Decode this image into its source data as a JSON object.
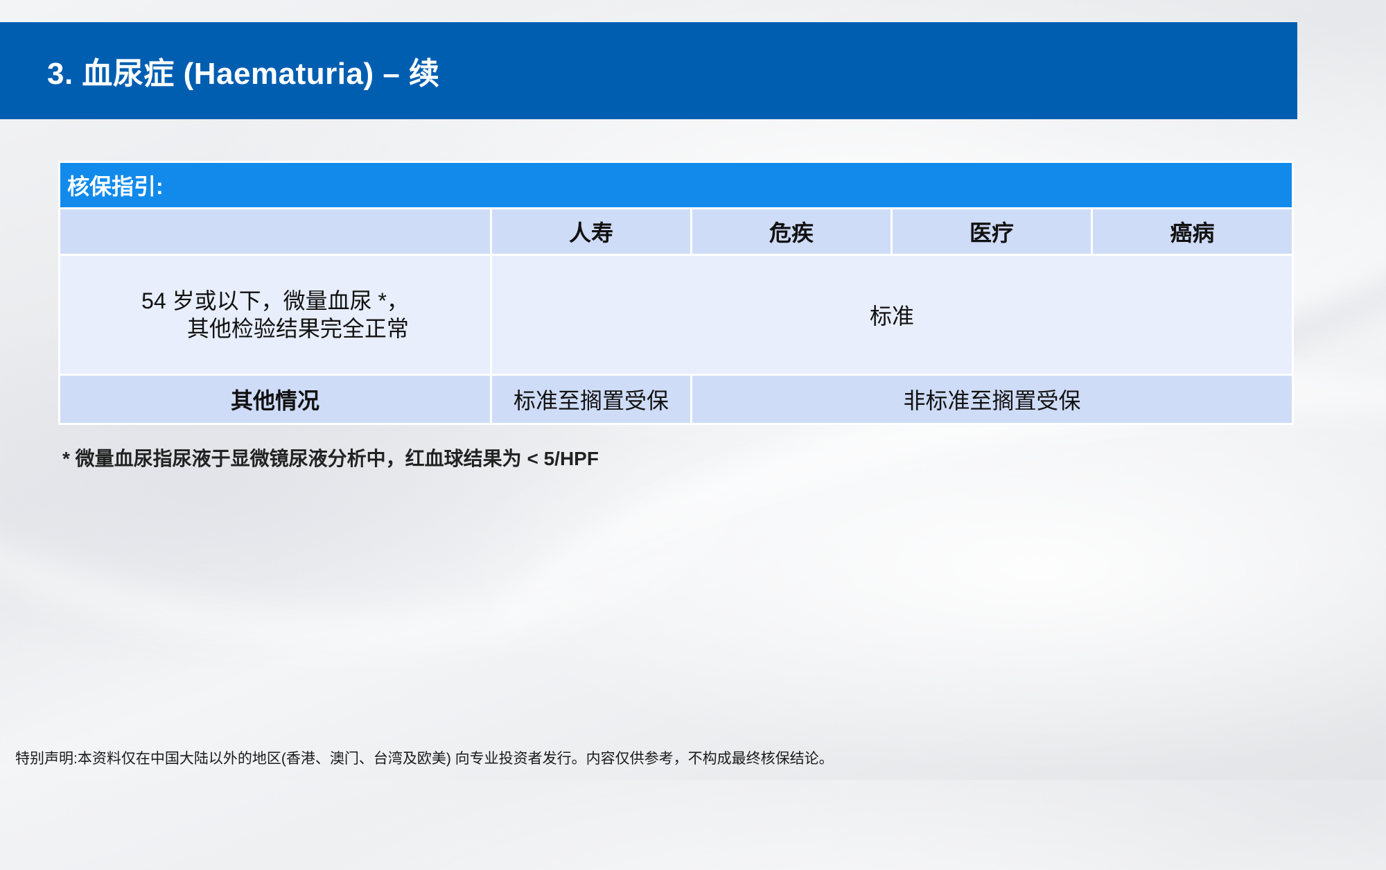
{
  "header": {
    "title": "3. 血尿症 (Haematuria) – 续"
  },
  "table": {
    "caption": "核保指引:",
    "columns": [
      "",
      "人寿",
      "危疾",
      "医疗",
      "癌病"
    ],
    "rows": [
      {
        "condition_lines": [
          "54 岁或以下，微量血尿 *，",
          "其他检验结果完全正常"
        ],
        "result_all": "标准"
      },
      {
        "condition": "其他情况",
        "result_life": "标准至搁置受保",
        "result_others": "非标准至搁置受保"
      }
    ]
  },
  "footnote": "* 微量血尿指尿液于显微镜尿液分析中，红血球结果为 < 5/HPF",
  "disclaimer": "特别声明:本资料仅在中国大陆以外的地区(香港、澳门、台湾及欧美) 向专业投资者发行。内容仅供参考，不构成最终核保结论。"
}
